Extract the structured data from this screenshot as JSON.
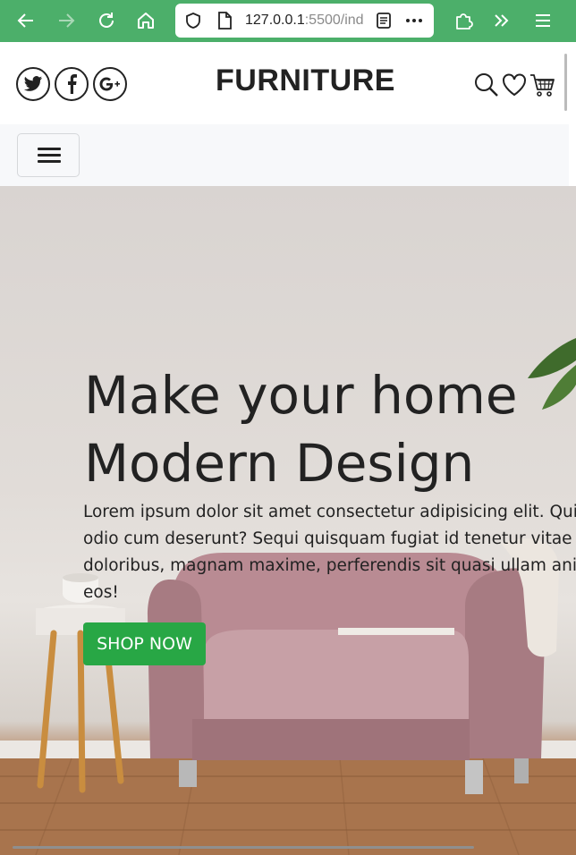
{
  "browser": {
    "url_host": "127.0.0.1",
    "url_rest": ":5500/ind",
    "icons": [
      "back-arrow-icon",
      "forward-arrow-icon",
      "reload-icon",
      "home-icon",
      "shield-icon",
      "page-icon",
      "reader-view-icon",
      "more-icon",
      "extensions-icon",
      "overflow-icon",
      "menu-icon"
    ],
    "toolbar_color": "#4caf6a"
  },
  "header": {
    "brand": "FURNITURE",
    "social": [
      "twitter-icon",
      "facebook-icon",
      "google-plus-icon"
    ],
    "actions": [
      "search-icon",
      "heart-icon",
      "cart-icon"
    ]
  },
  "navbar": {
    "toggle": "hamburger-menu-icon"
  },
  "hero": {
    "title_line1": "Make your home",
    "title_line2": "Modern Design",
    "text_line1": "Lorem ipsum dolor sit amet consectetur adipisicing elit. Quia e",
    "text_line2": "odio cum deserunt? Sequi quisquam fugiat id tenetur vitae qu",
    "text_line3": "doloribus, magnam maxime, perferendis sit quasi ullam animi",
    "text_line4": "eos!",
    "cta": "SHOP NOW",
    "cta_color": "#28a745"
  }
}
